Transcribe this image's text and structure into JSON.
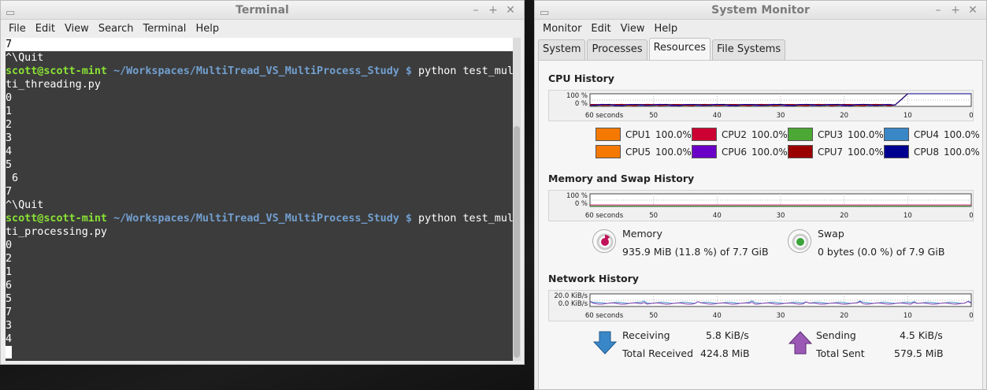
{
  "terminal": {
    "title": "Terminal",
    "menu": [
      "File",
      "Edit",
      "View",
      "Search",
      "Terminal",
      "Help"
    ],
    "lines": [
      {
        "type": "highlight",
        "text": "7"
      },
      {
        "type": "text",
        "text": "^\\Quit"
      },
      {
        "type": "prompt",
        "user": "scott@scott-mint",
        "path": "~/Workspaces/MultiTread_VS_MultiProcess_Study",
        "sym": "$",
        "cmd": "python test_mul"
      },
      {
        "type": "text",
        "text": "ti_threading.py"
      },
      {
        "type": "text",
        "text": "0"
      },
      {
        "type": "text",
        "text": "1"
      },
      {
        "type": "text",
        "text": "2"
      },
      {
        "type": "text",
        "text": "3"
      },
      {
        "type": "text",
        "text": "4"
      },
      {
        "type": "text",
        "text": "5"
      },
      {
        "type": "text",
        "text": " 6"
      },
      {
        "type": "text",
        "text": "7"
      },
      {
        "type": "text",
        "text": "^\\Quit"
      },
      {
        "type": "prompt",
        "user": "scott@scott-mint",
        "path": "~/Workspaces/MultiTread_VS_MultiProcess_Study",
        "sym": "$",
        "cmd": "python test_mul"
      },
      {
        "type": "text",
        "text": "ti_processing.py"
      },
      {
        "type": "text",
        "text": "0"
      },
      {
        "type": "text",
        "text": "2"
      },
      {
        "type": "text",
        "text": "1"
      },
      {
        "type": "text",
        "text": "6"
      },
      {
        "type": "text",
        "text": "5"
      },
      {
        "type": "text",
        "text": "7"
      },
      {
        "type": "text",
        "text": "3"
      },
      {
        "type": "text",
        "text": "4"
      },
      {
        "type": "cursor",
        "text": ""
      }
    ]
  },
  "sysmon": {
    "title": "System Monitor",
    "menu": [
      "Monitor",
      "Edit",
      "View",
      "Help"
    ],
    "tabs": [
      {
        "label": "System",
        "active": false
      },
      {
        "label": "Processes",
        "active": false
      },
      {
        "label": "Resources",
        "active": true
      },
      {
        "label": "File Systems",
        "active": false
      }
    ],
    "x_ticks": [
      "60 seconds",
      "50",
      "40",
      "30",
      "20",
      "10",
      "0"
    ],
    "cpu": {
      "title": "CPU History",
      "y_ticks": [
        "100 %",
        "0 %"
      ],
      "cores": [
        {
          "name": "CPU1",
          "value": "100.0%",
          "color": "#f57900"
        },
        {
          "name": "CPU2",
          "value": "100.0%",
          "color": "#cc0033"
        },
        {
          "name": "CPU3",
          "value": "100.0%",
          "color": "#4ca834"
        },
        {
          "name": "CPU4",
          "value": "100.0%",
          "color": "#3a87c8"
        },
        {
          "name": "CPU5",
          "value": "100.0%",
          "color": "#f57900"
        },
        {
          "name": "CPU6",
          "value": "100.0%",
          "color": "#6a00c8"
        },
        {
          "name": "CPU7",
          "value": "100.0%",
          "color": "#9a0000"
        },
        {
          "name": "CPU8",
          "value": "100.0%",
          "color": "#000090"
        }
      ]
    },
    "memory": {
      "title": "Memory and Swap History",
      "y_ticks": [
        "100 %",
        "0 %"
      ],
      "mem_label": "Memory",
      "mem_value": "935.9 MiB (11.8 %) of 7.7 GiB",
      "mem_color": "#c0135a",
      "swap_label": "Swap",
      "swap_value": "0 bytes (0.0 %) of 7.9 GiB",
      "swap_color": "#3aa33a"
    },
    "network": {
      "title": "Network History",
      "y_ticks": [
        "20.0 KiB/s",
        "0.0 KiB/s"
      ],
      "receiving_label": "Receiving",
      "receiving_value": "5.8 KiB/s",
      "total_received_label": "Total Received",
      "total_received_value": "424.8 MiB",
      "sending_label": "Sending",
      "sending_value": "4.5 KiB/s",
      "total_sent_label": "Total Sent",
      "total_sent_value": "579.5 MiB",
      "recv_color": "#3a87c8",
      "send_color": "#8e44ad"
    }
  }
}
